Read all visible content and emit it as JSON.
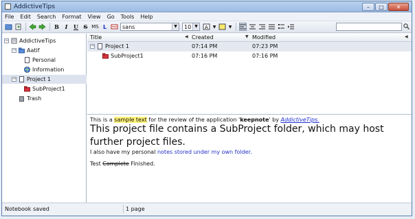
{
  "window": {
    "title": "AddictiveTips",
    "controls": [
      "–",
      "□",
      "✕"
    ]
  },
  "menubar": [
    "File",
    "Edit",
    "Search",
    "Format",
    "View",
    "Go",
    "Tools",
    "Help"
  ],
  "toolbar": {
    "format_buttons": [
      "B",
      "I",
      "U",
      "S",
      "MS",
      "L"
    ],
    "font_name": "sans",
    "font_size": "10",
    "search_placeholder": ""
  },
  "tree": [
    {
      "label": "AddictiveTips",
      "icon": "notebook-icon",
      "level": 0,
      "expanded": true
    },
    {
      "label": "Aatif",
      "icon": "folder-icon",
      "level": 1,
      "expanded": true
    },
    {
      "label": "Personal",
      "icon": "page-icon",
      "level": 2
    },
    {
      "label": "Information",
      "icon": "globe-icon",
      "level": 2
    },
    {
      "label": "Project 1",
      "icon": "page-icon",
      "level": 1,
      "expanded": true,
      "selected": true
    },
    {
      "label": "SubProject1",
      "icon": "red-folder-icon",
      "level": 2
    },
    {
      "label": "Trash",
      "icon": "trash-icon",
      "level": 1
    }
  ],
  "list": {
    "columns": [
      "Title",
      "Created",
      "Modified"
    ],
    "rows": [
      {
        "title": "Project 1",
        "created": "07:14 PM",
        "modified": "07:23 PM",
        "icon": "page-icon"
      },
      {
        "title": "SubProject1",
        "created": "07:16 PM",
        "modified": "07:16 PM",
        "icon": "red-folder-icon"
      }
    ]
  },
  "editor": {
    "line1_pre": "This is a ",
    "line1_highlight": "sample text",
    "line1_mid": " for the review of the application '",
    "line1_bold": "keepnote",
    "line1_after": "' by ",
    "line1_link": "AddictiveTips.",
    "heading": "This project file contains a SubProject folder, which may host further project files.",
    "line3_pre": "I also have my personal ",
    "line3_blue": "notes stored under my own folder.",
    "line4_pre": "Test ",
    "line4_strike": "Complete",
    "line4_after": " Finished."
  },
  "status": {
    "left": "Notebook saved",
    "right": "1 page"
  },
  "colors": {
    "highlight": "#fff37a",
    "link": "#1b2fd0",
    "folder_red": "#cc1f2a",
    "folder_blue": "#3a6fd0"
  }
}
